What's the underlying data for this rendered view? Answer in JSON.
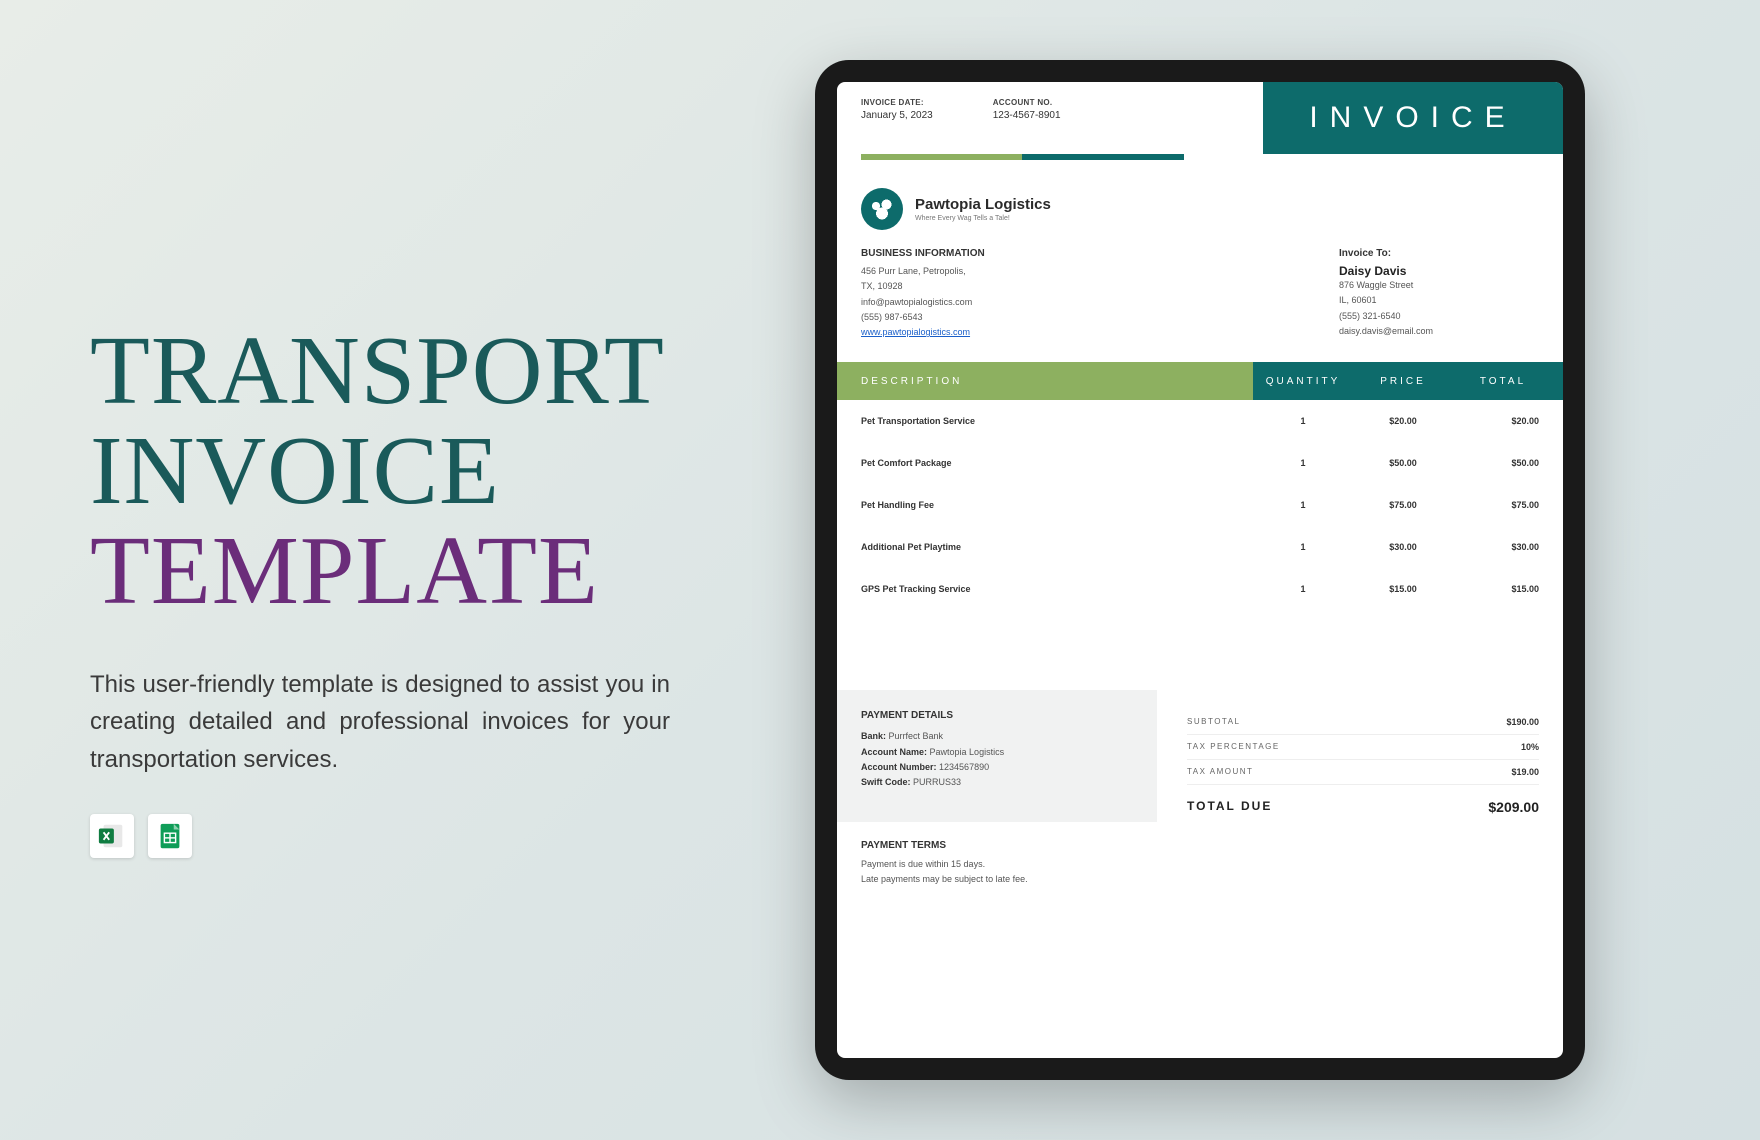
{
  "headline": {
    "line1": "TRANSPORT",
    "line2": "INVOICE",
    "line3": "TEMPLATE"
  },
  "description": "This user-friendly template is designed to assist you in creating detailed and professional invoices for your transportation services.",
  "icons": {
    "excel": "excel-icon",
    "sheets": "google-sheets-icon"
  },
  "invoice": {
    "dateLabel": "INVOICE DATE:",
    "date": "January 5, 2023",
    "accountLabel": "ACCOUNT NO.",
    "account": "123-4567-8901",
    "banner": "INVOICE",
    "company": {
      "name": "Pawtopia Logistics",
      "tagline": "Where Every Wag Tells a Tale!"
    },
    "bizHead": "BUSINESS INFORMATION",
    "biz": {
      "addr1": "456 Purr Lane, Petropolis,",
      "addr2": "TX, 10928",
      "email": "info@pawtopialogistics.com",
      "phone": "(555) 987-6543",
      "web": "www.pawtopialogistics.com"
    },
    "toHead": "Invoice To:",
    "to": {
      "name": "Daisy Davis",
      "addr1": "876 Waggle Street",
      "addr2": "IL, 60601",
      "phone": "(555) 321-6540",
      "email": "daisy.davis@email.com"
    },
    "th": {
      "desc": "DESCRIPTION",
      "qty": "QUANTITY",
      "price": "PRICE",
      "total": "TOTAL"
    },
    "items": [
      {
        "desc": "Pet Transportation Service",
        "qty": "1",
        "price": "$20.00",
        "total": "$20.00"
      },
      {
        "desc": "Pet Comfort Package",
        "qty": "1",
        "price": "$50.00",
        "total": "$50.00"
      },
      {
        "desc": "Pet Handling Fee",
        "qty": "1",
        "price": "$75.00",
        "total": "$75.00"
      },
      {
        "desc": "Additional Pet Playtime",
        "qty": "1",
        "price": "$30.00",
        "total": "$30.00"
      },
      {
        "desc": "GPS Pet Tracking Service",
        "qty": "1",
        "price": "$15.00",
        "total": "$15.00"
      }
    ],
    "payHead": "PAYMENT DETAILS",
    "pay": {
      "bankLabel": "Bank:",
      "bank": "Purrfect Bank",
      "nameLabel": "Account Name:",
      "name": "Pawtopia Logistics",
      "numLabel": "Account Number:",
      "num": "1234567890",
      "swiftLabel": "Swift Code:",
      "swift": "PURRUS33"
    },
    "totals": {
      "subLabel": "SUBTOTAL",
      "sub": "$190.00",
      "taxpLabel": "TAX PERCENTAGE",
      "taxp": "10%",
      "taxaLabel": "TAX AMOUNT",
      "taxa": "$19.00",
      "dueLabel": "TOTAL DUE",
      "due": "$209.00"
    },
    "termsHead": "PAYMENT TERMS",
    "terms": {
      "l1": "Payment is due within 15 days.",
      "l2": "Late payments may be subject to late fee."
    }
  }
}
